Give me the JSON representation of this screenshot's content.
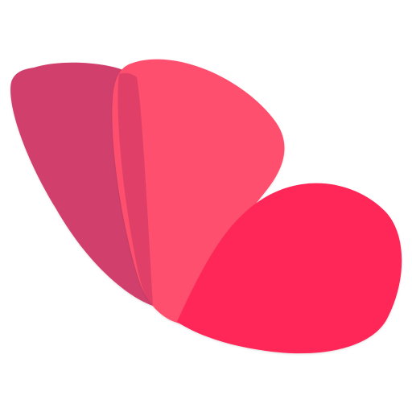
{
  "logo": {
    "icon": "petal-logo-icon",
    "colors": {
      "back_petal": "#d13f6c",
      "middle_petal": "#fe4f6e",
      "front_petal": "#ff2658",
      "overlap_shadow": "#c63563",
      "background": "#ffffff"
    }
  }
}
